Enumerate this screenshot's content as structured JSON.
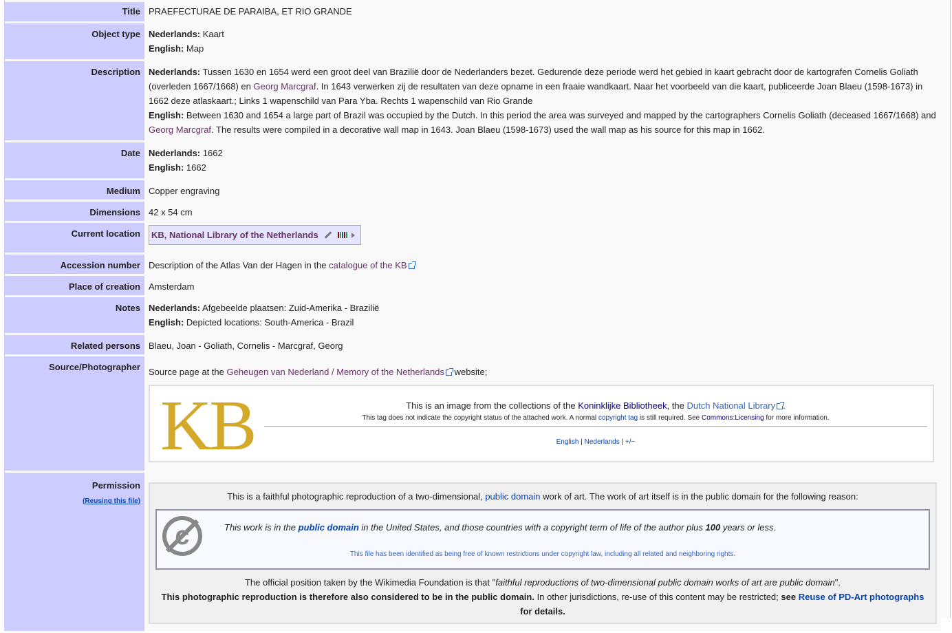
{
  "rows": {
    "title": {
      "label": "Title",
      "value": "PRAEFECTURAE DE PARAIBA, ET RIO GRANDE"
    },
    "object_type": {
      "label": "Object type",
      "nl_label": "Nederlands:",
      "nl": "Kaart",
      "en_label": "English:",
      "en": "Map"
    },
    "description": {
      "label": "Description",
      "nl_label": "Nederlands:",
      "nl_part1": "Tussen 1630 en 1654 werd een groot deel van Brazilië door de Nederlanders bezet. Gedurende deze periode werd het gebied in kaart gebracht door de kartografen Cornelis Goliath (overleden 1667/1668) en",
      "nl_link": "Georg Marcgraf",
      "nl_part2": ". In 1643 verwerken zij de resultaten van deze opname in een fraaie wandkaart. Naar het voorbeeld van die kaart, publiceerde Joan Blaeu (1598-1673) in 1662 deze atlaskaart.; Links 1 wapenschild van Para Yba. Rechts 1 wapenschild van Rio Grande",
      "en_label": "English:",
      "en_part1": "Between 1630 and 1654 a large part of Brazil was occupied by the Dutch. In this period the area was surveyed and mapped by the cartographers Cornelis Goliath (deceased 1667/1668) and",
      "en_link": "Georg Marcgraf",
      "en_part2": ". The results were compiled in a decorative wall map in 1643. Joan Blaeu (1598-1673) used the wall map as his source for this map in 1662."
    },
    "date": {
      "label": "Date",
      "nl_label": "Nederlands:",
      "nl": "1662",
      "en_label": "English:",
      "en": "1662"
    },
    "medium": {
      "label": "Medium",
      "value": "Copper engraving"
    },
    "dimensions": {
      "label": "Dimensions",
      "value": "42 x 54 cm"
    },
    "current_location": {
      "label": "Current location",
      "value": "KB, National Library of the Netherlands"
    },
    "accession": {
      "label": "Accession number",
      "text": "Description of the Atlas Van der Hagen in the",
      "link": "catalogue of the KB"
    },
    "place": {
      "label": "Place of creation",
      "value": "Amsterdam"
    },
    "notes": {
      "label": "Notes",
      "nl_label": "Nederlands:",
      "nl": "Afgebeelde plaatsen: Zuid-Amerika - Brazilië",
      "en_label": "English:",
      "en": "Depicted locations: South-America - Brazil"
    },
    "related": {
      "label": "Related persons",
      "value": "Blaeu, Joan - Goliath, Cornelis - Marcgraf, Georg"
    },
    "source": {
      "label": "Source/Photographer",
      "text1": "Source page at the",
      "link": "Geheugen van Nederland / Memory of the Netherlands",
      "text2": "website;",
      "kb": {
        "logo": "KB",
        "main1": "This is an image from the collections of the",
        "link1": "Koninklijke Bibliotheek",
        "main2": ", the",
        "link2": "Dutch National Library",
        "main3": ".",
        "small1": "This tag does not indicate the copyright status of the attached work. A normal",
        "small_link1": "copyright tag",
        "small2": "is still required. See",
        "small_link2": "Commons:Licensing",
        "small3": "for more information.",
        "lang1": "English",
        "sep": "|",
        "lang2": "Nederlands",
        "sep2": "|",
        "lang3": "+/−"
      }
    },
    "permission": {
      "label": "Permission",
      "sub": "(Reusing this file)",
      "intro1": "This is a faithful photographic reproduction of a two-dimensional,",
      "intro_link": "public domain",
      "intro2": "work of art. The work of art itself is in the public domain for the following reason:",
      "pd1": "This work is in the",
      "pd_link": "public domain",
      "pd2": "in the United States, and those countries with a copyright term of life of the author plus",
      "pd_years": "100",
      "pd3": "years or less.",
      "pd_small": "This file has been identified as being free of known restrictions under copyright law, including all related and neighboring rights.",
      "wmf1": "The official position taken by the Wikimedia Foundation is that \"",
      "wmf_quote": "faithful reproductions of two-dimensional public domain works of art are public domain",
      "wmf2": "\".",
      "bold1": "This photographic reproduction is therefore also considered to be in the public domain.",
      "mid": "In other jurisdictions, re-use of this content may be restricted;",
      "bold2": "see",
      "link": "Reuse of PD-Art photographs",
      "bold3": "for details."
    }
  },
  "colors": {
    "label_bg": "#ccccff",
    "link_visited": "#663366",
    "link": "#0645ad",
    "kb_gold": "#d4a92a"
  }
}
